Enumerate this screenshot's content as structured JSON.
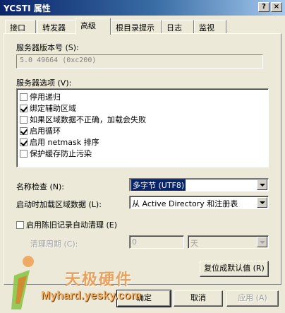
{
  "window": {
    "title": "YCSTI 属性",
    "help_button": "?",
    "close_button": "×"
  },
  "tabs": [
    {
      "label": "接口"
    },
    {
      "label": "转发器"
    },
    {
      "label": "高级",
      "active": true
    },
    {
      "label": "根目录提示"
    },
    {
      "label": "日志"
    },
    {
      "label": "监视"
    }
  ],
  "advanced": {
    "version_label": "服务器版本号 (S):",
    "version_value": "5.0 49664 (0xc200)",
    "options_label": "服务器选项 (V):",
    "options": [
      {
        "label": "停用递归",
        "checked": false
      },
      {
        "label": "绑定辅助区域",
        "checked": true
      },
      {
        "label": "如果区域数据不正确，加载会失败",
        "checked": false
      },
      {
        "label": "启用循环",
        "checked": true
      },
      {
        "label": "启用 netmask 排序",
        "checked": true
      },
      {
        "label": "保护缓存防止污染",
        "checked": false
      }
    ],
    "name_check_label": "名称检查 (N):",
    "name_check_value": "多字节 (UTF8)",
    "load_zone_label": "启动时加载区域数据 (L):",
    "load_zone_value": "从 Active Directory 和注册表",
    "scavenging_label": "启用陈旧记录自动清理 (E)",
    "scavenging_checked": false,
    "period_label": "清理周期 (C):",
    "period_value": "0",
    "period_unit": "天",
    "reset_button": "复位成默认值 (R)"
  },
  "footer": {
    "ok_button": "确定",
    "cancel_button": "取消",
    "apply_button": "应用 (A)"
  },
  "watermark": {
    "text_cn": "天极硬件",
    "text_en": "Myhard.yesky.com"
  }
}
